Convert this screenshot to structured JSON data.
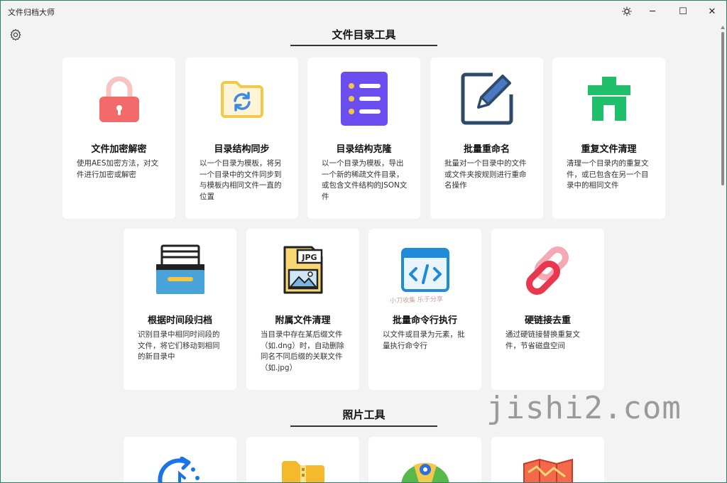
{
  "window": {
    "title": "文件归档大师"
  },
  "titlebar": {
    "theme_icon": "sun-icon",
    "minimize": "─",
    "maximize": "☐",
    "close": "✕"
  },
  "sections": [
    {
      "title": "文件目录工具"
    },
    {
      "title": "照片工具"
    }
  ],
  "cards": [
    {
      "title": "文件加密解密",
      "desc": "使用AES加密方法，对文件进行加密或解密",
      "icon": "lock-icon"
    },
    {
      "title": "目录结构同步",
      "desc": "以一个目录为模板，将另一个目录中的文件同步到与模板内相同文件一直的位置",
      "icon": "folder-sync-icon"
    },
    {
      "title": "目录结构克隆",
      "desc": "以一个目录为模板，导出一个新的稀疏文件目录，或包含文件结构的JSON文件",
      "icon": "list-icon"
    },
    {
      "title": "批量重命名",
      "desc": "批量对一个目录中的文件或文件夹按规则进行重命名操作",
      "icon": "edit-icon"
    },
    {
      "title": "重复文件清理",
      "desc": "清理一个目录内的重复文件，或已包含在另一个目录中的相同文件",
      "icon": "trash-icon"
    },
    {
      "title": "根据时间段归档",
      "desc": "识别目录中相同时间段的文件，将它们移动到相同的新目录中",
      "icon": "archive-drawer-icon"
    },
    {
      "title": "附属文件清理",
      "desc": "当目录中存在某后缀文件（如.dng）时，自动删除同名不同后缀的关联文件（如.jpg）",
      "icon": "jpg-file-icon"
    },
    {
      "title": "批量命令行执行",
      "desc": "以文件或目录为元素，批量执行命令行",
      "icon": "code-window-icon"
    },
    {
      "title": "硬链接去重",
      "desc": "通过硬链接替换重复文件，节省磁盘空间",
      "icon": "link-icon"
    }
  ],
  "photo_cards": [
    {
      "icon": "timer-icon"
    },
    {
      "icon": "zip-folder-icon"
    },
    {
      "icon": "map-pin-icon"
    },
    {
      "icon": "map-icon"
    }
  ],
  "jpg_label": "JPG",
  "watermark": "jishi2.com",
  "watermark_small": "小刀收集 乐于分享"
}
